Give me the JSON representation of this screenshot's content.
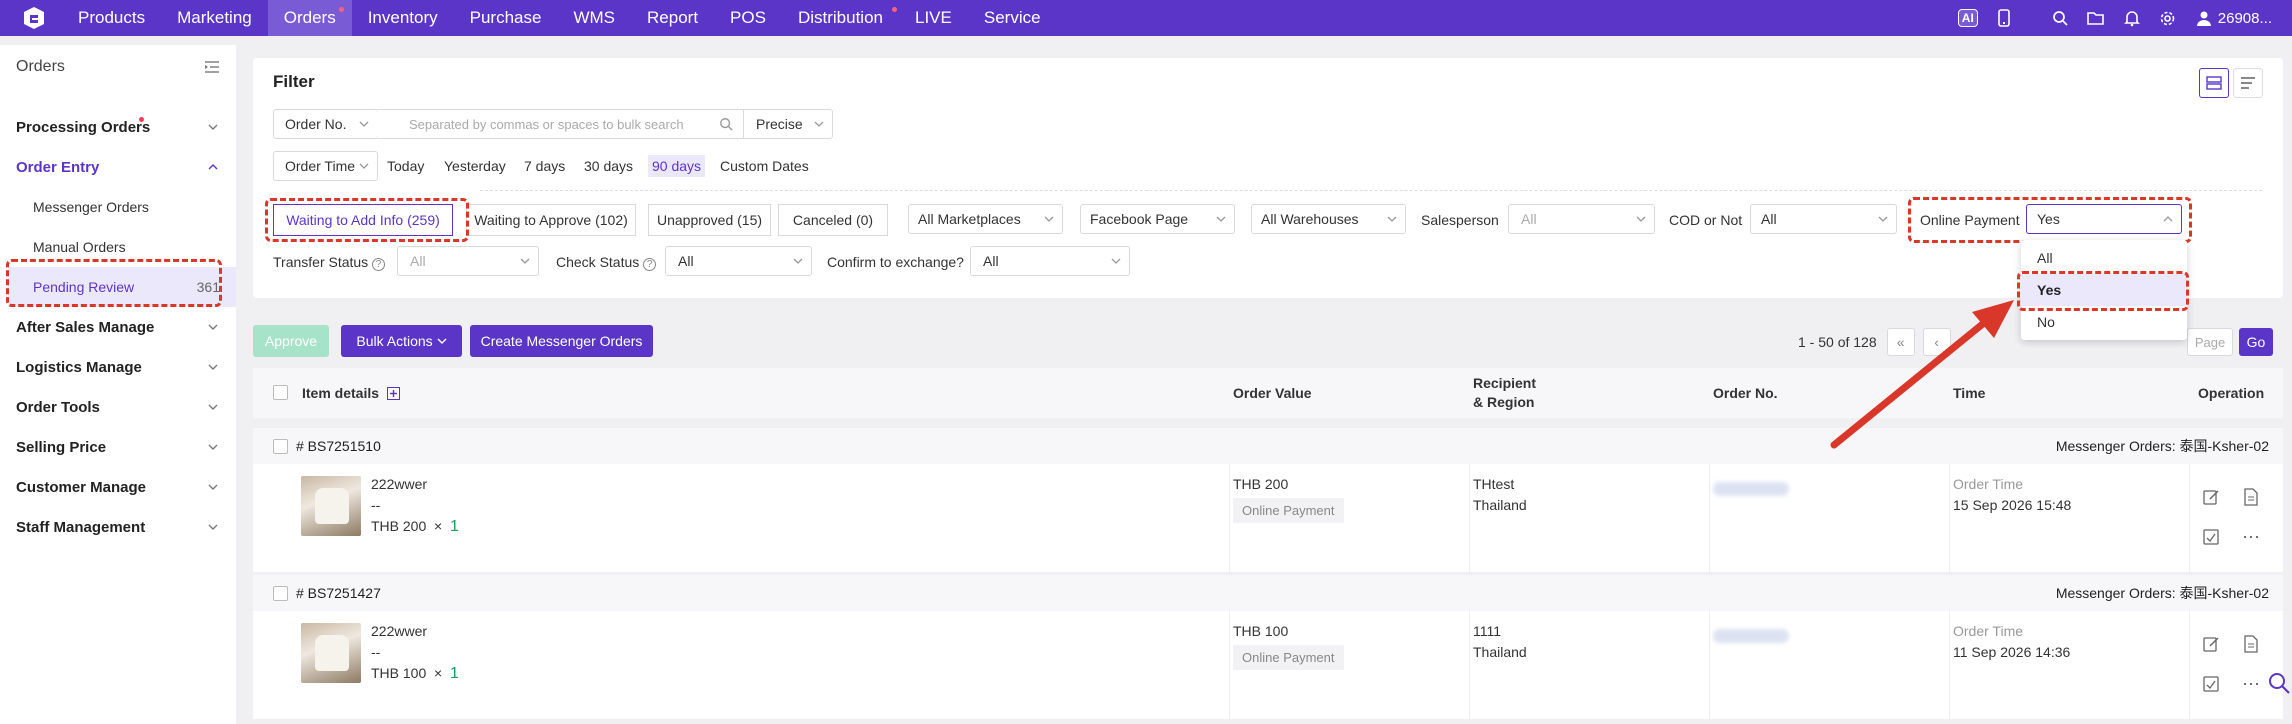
{
  "topbar": {
    "nav": [
      "Products",
      "Marketing",
      "Orders",
      "Inventory",
      "Purchase",
      "WMS",
      "Report",
      "POS",
      "Distribution",
      "LIVE",
      "Service"
    ],
    "active": "Orders",
    "ai_label": "AI",
    "user": "26908..."
  },
  "sidebar": {
    "title": "Orders",
    "groups": {
      "processing": "Processing Orders",
      "order_entry": "Order Entry",
      "after_sales": "After Sales Manage",
      "logistics": "Logistics Manage",
      "order_tools": "Order Tools",
      "selling_price": "Selling Price",
      "customer": "Customer Manage",
      "staff": "Staff Management"
    },
    "sub": {
      "messenger": "Messenger Orders",
      "manual": "Manual Orders",
      "pending": "Pending Review",
      "pending_count": "361"
    }
  },
  "filter": {
    "title": "Filter",
    "order_no_select": "Order No.",
    "search_placeholder": "Separated by commas or spaces to bulk search",
    "precise": "Precise",
    "order_time": "Order Time",
    "quick_dates": [
      "Today",
      "Yesterday",
      "7 days",
      "30 days",
      "90 days",
      "Custom Dates"
    ],
    "quick_selected": "90 days",
    "tabs": [
      "Waiting to Add Info (259)",
      "Waiting to Approve (102)",
      "Unapproved (15)",
      "Canceled (0)"
    ],
    "marketplaces": "All Marketplaces",
    "facebook": "Facebook Page",
    "warehouses": "All Warehouses",
    "salesperson_label": "Salesperson",
    "salesperson_value": "All",
    "cod_label": "COD or Not",
    "cod_value": "All",
    "online_payment_label": "Online Payment",
    "online_payment_value": "Yes",
    "transfer_label": "Transfer Status",
    "transfer_value": "All",
    "check_label": "Check Status",
    "check_value": "All",
    "exchange_label": "Confirm to exchange?",
    "exchange_value": "All",
    "dropdown_options": [
      "All",
      "Yes",
      "No"
    ],
    "dropdown_selected": "Yes"
  },
  "toolbar": {
    "approve": "Approve",
    "bulk": "Bulk Actions",
    "create": "Create Messenger Orders",
    "range": "1 - 50 of 128",
    "page_placeholder": "Page",
    "go": "Go"
  },
  "table": {
    "headers": {
      "item": "Item details",
      "value": "Order Value",
      "recipient1": "Recipient",
      "recipient2": "& Region",
      "order_no": "Order No.",
      "time": "Time",
      "operation": "Operation"
    },
    "orders": [
      {
        "id": "# BS7251510",
        "source": "Messenger Orders: 泰国-Ksher-02",
        "item_name": "222wwer",
        "item_variant": "--",
        "item_price": "THB 200",
        "qty_sep": "×",
        "qty": "1",
        "value": "THB 200",
        "payment": "Online Payment",
        "recipient": "THtest",
        "region": "Thailand",
        "time_label": "Order Time",
        "time": "15 Sep 2026 15:48"
      },
      {
        "id": "# BS7251427",
        "source": "Messenger Orders: 泰国-Ksher-02",
        "item_name": "222wwer",
        "item_variant": "--",
        "item_price": "THB 100",
        "qty_sep": "×",
        "qty": "1",
        "value": "THB 100",
        "payment": "Online Payment",
        "recipient": "1111",
        "region": "Thailand",
        "time_label": "Order Time",
        "time": "11 Sep 2026 14:36"
      }
    ]
  },
  "colors": {
    "brand": "#5b35c7",
    "annotation": "#d9372a",
    "approve_disabled": "#a7e3c9",
    "qty": "#1aa05a"
  }
}
